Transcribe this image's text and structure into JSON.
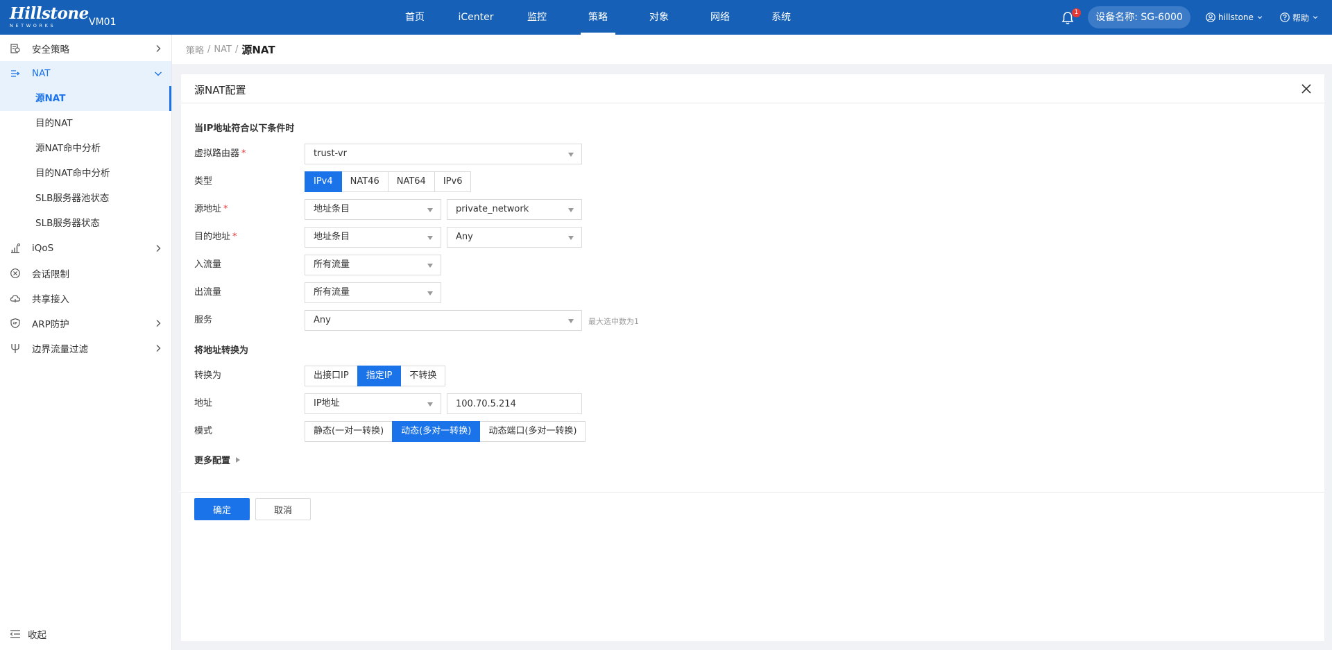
{
  "colors": {
    "topbar": "#1660b8",
    "accent": "#1a73e8",
    "badge": "#e53935",
    "active_bg": "#e8f2fd"
  },
  "header": {
    "logo_main": "Hillstone",
    "logo_sub": "NETWORKS",
    "device_label": "VM01",
    "nav": [
      "首页",
      "iCenter",
      "监控",
      "策略",
      "对象",
      "网络",
      "系统"
    ],
    "nav_active": "策略",
    "notification_count": "1",
    "device_name": "设备名称: SG-6000",
    "user": "hillstone",
    "help": "帮助"
  },
  "sidebar": {
    "items": [
      {
        "label": "安全策略",
        "icon": "security-policy-icon"
      },
      {
        "label": "NAT",
        "icon": "nat-icon"
      },
      {
        "label": "iQoS",
        "icon": "bar-chart-icon"
      },
      {
        "label": "会话限制",
        "icon": "circle-x-icon"
      },
      {
        "label": "共享接入",
        "icon": "cloud-icon"
      },
      {
        "label": "ARP防护",
        "icon": "arp-shield-icon"
      },
      {
        "label": "边界流量过滤",
        "icon": "filter-fork-icon"
      }
    ],
    "nat_sub": [
      "源NAT",
      "目的NAT",
      "源NAT命中分析",
      "目的NAT命中分析",
      "SLB服务器池状态",
      "SLB服务器状态"
    ],
    "collapse": "收起"
  },
  "breadcrumb": {
    "p1": "策略",
    "p2": "NAT",
    "current": "源NAT",
    "sep": "/"
  },
  "panel": {
    "title": "源NAT配置",
    "section1": "当IP地址符合以下条件时",
    "labels": {
      "vrouter": "虚拟路由器",
      "type": "类型",
      "src": "源地址",
      "dst": "目的地址",
      "ingress": "入流量",
      "egress": "出流量",
      "service": "服务"
    },
    "required_mark": "*",
    "vrouter_value": "trust-vr",
    "type_options": [
      "IPv4",
      "NAT46",
      "NAT64",
      "IPv6"
    ],
    "type_selected": "IPv4",
    "src_kind": "地址条目",
    "src_value": "private_network",
    "dst_kind": "地址条目",
    "dst_value": "Any",
    "ingress_value": "所有流量",
    "egress_value": "所有流量",
    "service_value": "Any",
    "service_hint": "最大选中数为1",
    "section2": "将地址转换为",
    "labels2": {
      "convert": "转换为",
      "address": "地址",
      "mode": "模式"
    },
    "convert_options": [
      "出接口IP",
      "指定IP",
      "不转换"
    ],
    "convert_selected": "指定IP",
    "address_kind": "IP地址",
    "address_value": "100.70.5.214",
    "mode_options": [
      "静态(一对一转换)",
      "动态(多对一转换)",
      "动态端口(多对一转换)"
    ],
    "mode_selected": "动态(多对一转换)",
    "more": "更多配置",
    "ok": "确定",
    "cancel": "取消"
  }
}
